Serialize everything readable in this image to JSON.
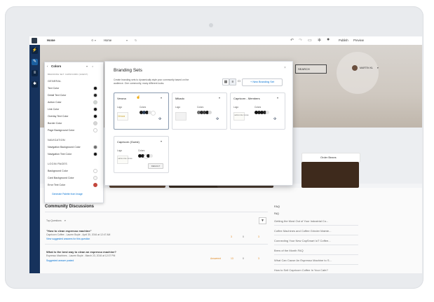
{
  "toolbar": {
    "page_label": "Home",
    "page_select": "Home",
    "publish_label": "Publish",
    "preview_label": "Preview"
  },
  "colors_panel": {
    "title": "Colors",
    "subtitle": "BRANDING SET: CAPRICORN (GUEST)",
    "sections": [
      {
        "heading": "GENERAL",
        "items": [
          {
            "label": "Text Color",
            "color": "#111111"
          },
          {
            "label": "Detail Text Color",
            "color": "#222222"
          },
          {
            "label": "Action Color",
            "color": "#cfd6d2"
          },
          {
            "label": "Link Color",
            "color": "#111111"
          },
          {
            "label": "Overlay Text Color",
            "color": "#111111"
          },
          {
            "label": "Border Color",
            "color": "#d6d6d6"
          },
          {
            "label": "Page Background Color",
            "color": "#ffffff"
          }
        ]
      },
      {
        "heading": "NAVIGATION",
        "items": [
          {
            "label": "Navigation Background Color",
            "color": "#6b6b6b"
          },
          {
            "label": "Navigation Text Color",
            "color": "#111111"
          }
        ]
      },
      {
        "heading": "LOGIN PAGES",
        "items": [
          {
            "label": "Background Color",
            "color": "#ffffff"
          },
          {
            "label": "Card Background Color",
            "color": "#f4f4f4"
          },
          {
            "label": "Error Text Color",
            "color": "#c2463c"
          }
        ]
      }
    ],
    "generate_link": "Generate Palette from Image"
  },
  "modal": {
    "title": "Branding Sets",
    "description_line1": "Create branding sets to dynamically style your community based on the",
    "description_line2": "audience. One community, many different looks.",
    "new_button": "+ New Branding Set",
    "cards": [
      {
        "name": "Verona",
        "logo_label": "Logo",
        "colors_label": "Colors",
        "logo_text": "Verona",
        "dots": [
          "#1b1b1b",
          "#2b3c55",
          "#1a1a1a",
          "#e3e3e3",
          "#ffffff"
        ]
      },
      {
        "name": "Mikado",
        "logo_label": "Logo",
        "colors_label": "Colors",
        "logo_text": "",
        "dots": [
          "#6e6e6e",
          "#2b2b2b",
          "#444444",
          "#1d1d1d",
          "#d9d9d9"
        ]
      },
      {
        "name": "Capricorn - Members",
        "logo_label": "Logo",
        "colors_label": "Colors",
        "logo_text": "CAPRICORN COFFEE",
        "dots": [
          "#111111",
          "#1c1c1c",
          "#141414",
          "#2a2a2a",
          "#e6e6e6"
        ]
      },
      {
        "name": "Capricorn (Guest)",
        "logo_label": "Logo",
        "colors_label": "Colors",
        "logo_text": "CAPRICORN COFFEE",
        "dots": [
          "#111111",
          "#1d1d1d",
          "#ffffff",
          "#1a1a1a",
          "#e7e7e7"
        ],
        "default_badge": "DEFAULT"
      }
    ]
  },
  "hero": {
    "search_label": "SEARCH",
    "user_label": "MARTIN KL"
  },
  "tiles": {
    "order_beans": "Order Beans"
  },
  "discussions": {
    "title": "Community Discussions",
    "filter": "Top Questions",
    "posts": [
      {
        "title": "\"How to clean espresso machine\"",
        "meta": "Capricorn Coffee - Lauren Boyle - April 30, 2016 at 12:47 AM",
        "suggest": "View suggested answers for this question",
        "likes": "3",
        "votes": "0",
        "comments": "3"
      },
      {
        "title": "What is the best way to clean an espresso machine?",
        "meta": "Espresso Machines - Lauren Boyle - March 23, 2016 at 12:07 PM",
        "suggest": "Suggested answer posted",
        "answered": "Answered",
        "likes": "13",
        "votes": "0",
        "comments": "3"
      }
    ]
  },
  "faq": {
    "title": "FAQ",
    "subtitle": "FAQ",
    "items": [
      "Getting the Most Out of Your Industrial Co...",
      "Coffee Machines and Coffee Grinder Mainte...",
      "Connecting Your New CapSmart IoT Coffee...",
      "Brew of the Month FAQ",
      "What Can Cause An Espresso Machine to S...",
      "How to Sell Capricorn Coffee In Your Cafe?"
    ]
  }
}
